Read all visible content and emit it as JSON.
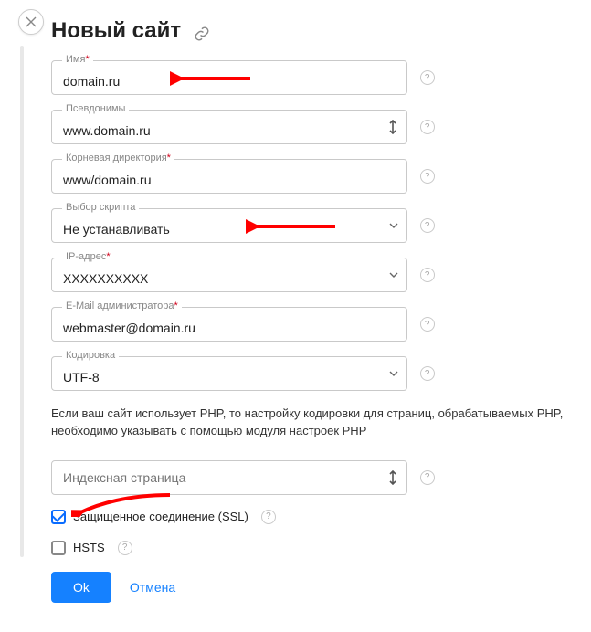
{
  "header": {
    "title": "Новый сайт"
  },
  "fields": {
    "name": {
      "label": "Имя",
      "required": true,
      "value": "domain.ru"
    },
    "aliases": {
      "label": "Псевдонимы",
      "required": false,
      "value": "www.domain.ru"
    },
    "root": {
      "label": "Корневая директория",
      "required": true,
      "value": "www/domain.ru"
    },
    "script": {
      "label": "Выбор скрипта",
      "required": false,
      "value": "Не устанавливать"
    },
    "ip": {
      "label": "IP-адрес",
      "required": true,
      "value": "XXXXXXXXXX"
    },
    "email": {
      "label": "E-Mail администратора",
      "required": true,
      "value": "webmaster@domain.ru"
    },
    "encoding": {
      "label": "Кодировка",
      "required": false,
      "value": "UTF-8"
    },
    "index": {
      "placeholder": "Индексная страница"
    }
  },
  "note": "Если ваш сайт использует PHP, то настройку кодировки для страниц, обрабатываемых PHP, необходимо указывать с помощью модуля настроек PHP",
  "checks": {
    "ssl": {
      "label": "Защищенное соединение (SSL)",
      "checked": true
    },
    "hsts": {
      "label": "HSTS",
      "checked": false
    }
  },
  "actions": {
    "ok": "Ok",
    "cancel": "Отмена"
  },
  "help_glyph": "?",
  "required_glyph": "*",
  "colors": {
    "accent": "#1581ff",
    "danger": "#d0021b",
    "arrow": "#ff0000"
  }
}
